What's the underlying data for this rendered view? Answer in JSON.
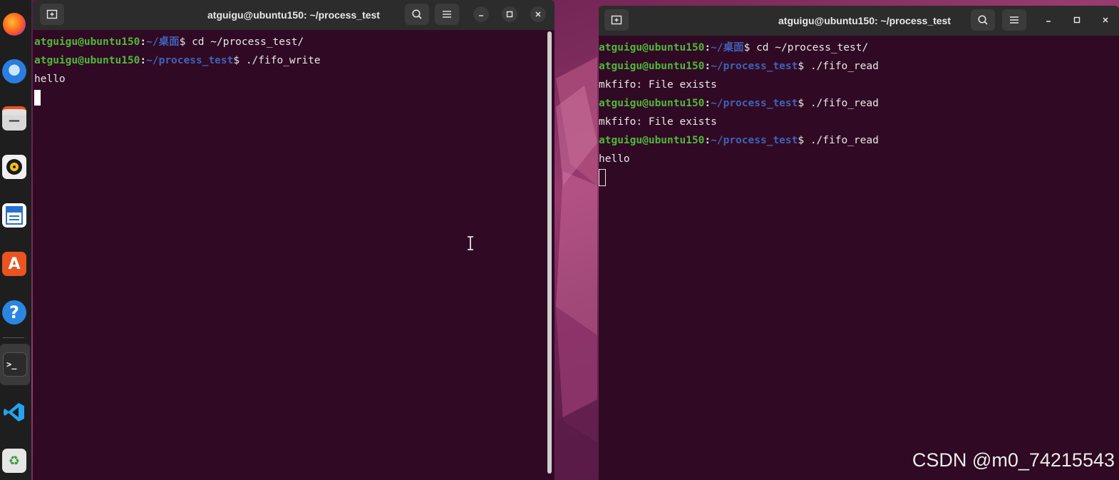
{
  "dock": {
    "items": [
      {
        "name": "firefox-icon"
      },
      {
        "name": "thunderbird-icon"
      },
      {
        "name": "files-icon"
      },
      {
        "name": "rhythmbox-icon"
      },
      {
        "name": "writer-icon"
      },
      {
        "name": "app-center-icon"
      },
      {
        "name": "help-icon"
      },
      {
        "name": "terminal-icon"
      },
      {
        "name": "vscode-icon"
      },
      {
        "name": "trash-icon"
      }
    ]
  },
  "left_terminal": {
    "title": "atguigu@ubuntu150: ~/process_test",
    "lines": [
      {
        "user": "atguigu@ubuntu150",
        "path": "~/桌面",
        "cmd": "$ cd ~/process_test/"
      },
      {
        "user": "atguigu@ubuntu150",
        "path": "~/process_test",
        "cmd": "$ ./fifo_write"
      },
      {
        "output": "hello"
      }
    ]
  },
  "right_terminal": {
    "title": "atguigu@ubuntu150: ~/process_test",
    "lines": [
      {
        "user": "atguigu@ubuntu150",
        "path": "~/桌面",
        "cmd": "$ cd ~/process_test/"
      },
      {
        "user": "atguigu@ubuntu150",
        "path": "~/process_test",
        "cmd": "$ ./fifo_read"
      },
      {
        "output": "mkfifo: File exists"
      },
      {
        "user": "atguigu@ubuntu150",
        "path": "~/process_test",
        "cmd": "$ ./fifo_read"
      },
      {
        "output": "mkfifo: File exists"
      },
      {
        "user": "atguigu@ubuntu150",
        "path": "~/process_test",
        "cmd": "$ ./fifo_read"
      },
      {
        "output": "hello"
      }
    ]
  },
  "titlebar_icons": {
    "new_tab": "new-tab-icon",
    "search": "search-icon",
    "menu": "hamburger-menu-icon",
    "minimize": "minimize-icon",
    "maximize": "maximize-icon",
    "close": "close-icon"
  },
  "watermark": "CSDN @m0_74215543"
}
